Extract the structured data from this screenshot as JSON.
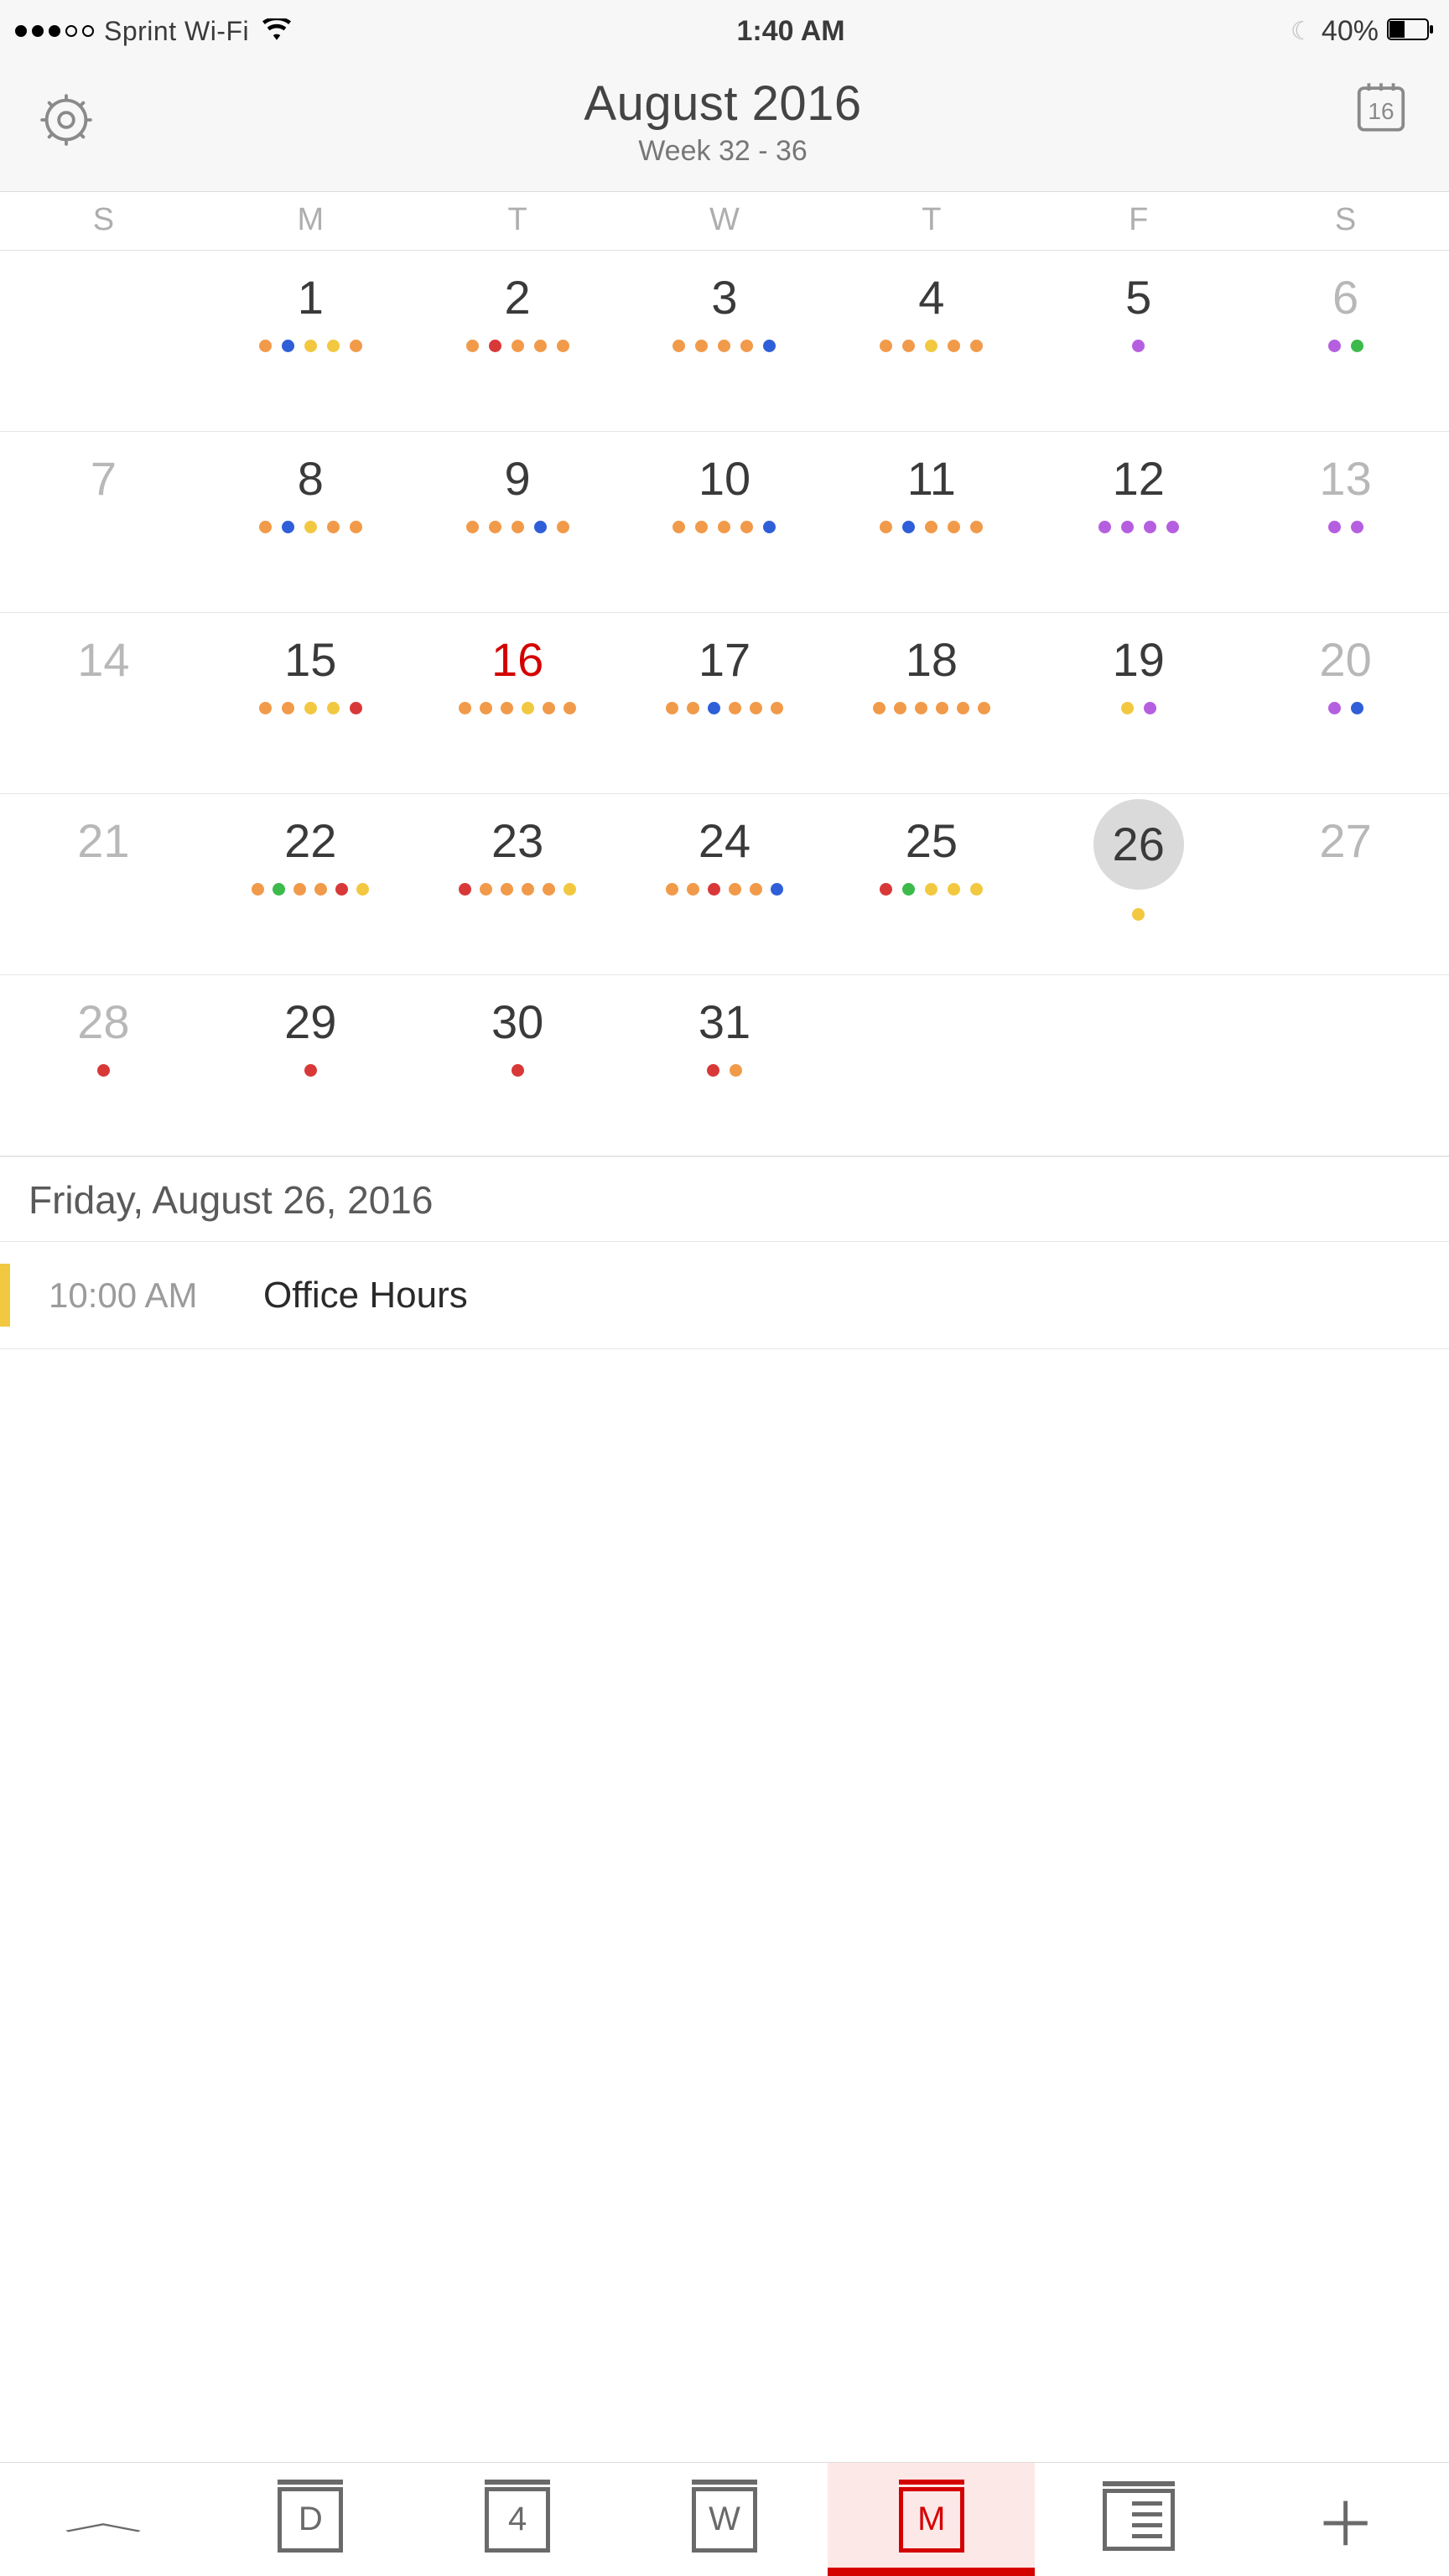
{
  "status": {
    "carrier": "Sprint Wi-Fi",
    "time": "1:40 AM",
    "battery_pct": "40%"
  },
  "header": {
    "title": "August 2016",
    "subtitle": "Week 32 - 36",
    "cal_icon_day": "16"
  },
  "weekdays": [
    "S",
    "M",
    "T",
    "W",
    "T",
    "F",
    "S"
  ],
  "calendar": {
    "today": 16,
    "selected": 26,
    "rows": [
      [
        {
          "n": "",
          "muted": false,
          "dots": []
        },
        {
          "n": "1",
          "dots": [
            "orange",
            "blue",
            "yellow",
            "yellow",
            "orange"
          ]
        },
        {
          "n": "2",
          "dots": [
            "orange",
            "red",
            "orange",
            "orange",
            "orange"
          ]
        },
        {
          "n": "3",
          "dots": [
            "orange",
            "orange",
            "orange",
            "orange",
            "blue"
          ]
        },
        {
          "n": "4",
          "dots": [
            "orange",
            "orange",
            "yellow",
            "orange",
            "orange"
          ]
        },
        {
          "n": "5",
          "dots": [
            "violet"
          ]
        },
        {
          "n": "6",
          "muted": true,
          "dots": [
            "violet",
            "green"
          ]
        }
      ],
      [
        {
          "n": "7",
          "muted": true,
          "dots": []
        },
        {
          "n": "8",
          "dots": [
            "orange",
            "blue",
            "yellow",
            "orange",
            "orange"
          ]
        },
        {
          "n": "9",
          "dots": [
            "orange",
            "orange",
            "orange",
            "blue",
            "orange"
          ]
        },
        {
          "n": "10",
          "dots": [
            "orange",
            "orange",
            "orange",
            "orange",
            "blue"
          ]
        },
        {
          "n": "11",
          "dots": [
            "orange",
            "blue",
            "orange",
            "orange",
            "orange"
          ]
        },
        {
          "n": "12",
          "dots": [
            "violet",
            "violet",
            "violet",
            "violet"
          ]
        },
        {
          "n": "13",
          "muted": true,
          "dots": [
            "violet",
            "violet"
          ]
        }
      ],
      [
        {
          "n": "14",
          "muted": true,
          "dots": []
        },
        {
          "n": "15",
          "dots": [
            "orange",
            "orange",
            "yellow",
            "yellow",
            "red"
          ]
        },
        {
          "n": "16",
          "today": true,
          "dots": [
            "orange",
            "orange",
            "orange",
            "yellow",
            "orange",
            "orange"
          ]
        },
        {
          "n": "17",
          "dots": [
            "orange",
            "orange",
            "blue",
            "orange",
            "orange",
            "orange"
          ]
        },
        {
          "n": "18",
          "dots": [
            "orange",
            "orange",
            "orange",
            "orange",
            "orange",
            "orange"
          ]
        },
        {
          "n": "19",
          "dots": [
            "yellow",
            "violet"
          ]
        },
        {
          "n": "20",
          "muted": true,
          "dots": [
            "violet",
            "blue"
          ]
        }
      ],
      [
        {
          "n": "21",
          "muted": true,
          "dots": []
        },
        {
          "n": "22",
          "dots": [
            "orange",
            "green",
            "orange",
            "orange",
            "red",
            "yellow"
          ]
        },
        {
          "n": "23",
          "dots": [
            "red",
            "orange",
            "orange",
            "orange",
            "orange",
            "yellow"
          ]
        },
        {
          "n": "24",
          "dots": [
            "orange",
            "orange",
            "red",
            "orange",
            "orange",
            "blue"
          ]
        },
        {
          "n": "25",
          "dots": [
            "red",
            "green",
            "yellow",
            "yellow",
            "yellow"
          ]
        },
        {
          "n": "26",
          "selected": true,
          "dots": [
            "yellow"
          ]
        },
        {
          "n": "27",
          "muted": true,
          "dots": []
        }
      ],
      [
        {
          "n": "28",
          "muted": true,
          "dots": [
            "red"
          ]
        },
        {
          "n": "29",
          "dots": [
            "red"
          ]
        },
        {
          "n": "30",
          "dots": [
            "red"
          ]
        },
        {
          "n": "31",
          "dots": [
            "red",
            "orange"
          ]
        },
        {
          "n": "",
          "dots": []
        },
        {
          "n": "",
          "dots": []
        },
        {
          "n": "",
          "dots": []
        }
      ]
    ]
  },
  "selected_day": {
    "label": "Friday, August 26, 2016",
    "events": [
      {
        "time": "10:00 AM",
        "title": "Office Hours",
        "color": "#f2c840"
      }
    ]
  },
  "bottom_tabs": {
    "day": "D",
    "four": "4",
    "week": "W",
    "month": "M"
  }
}
